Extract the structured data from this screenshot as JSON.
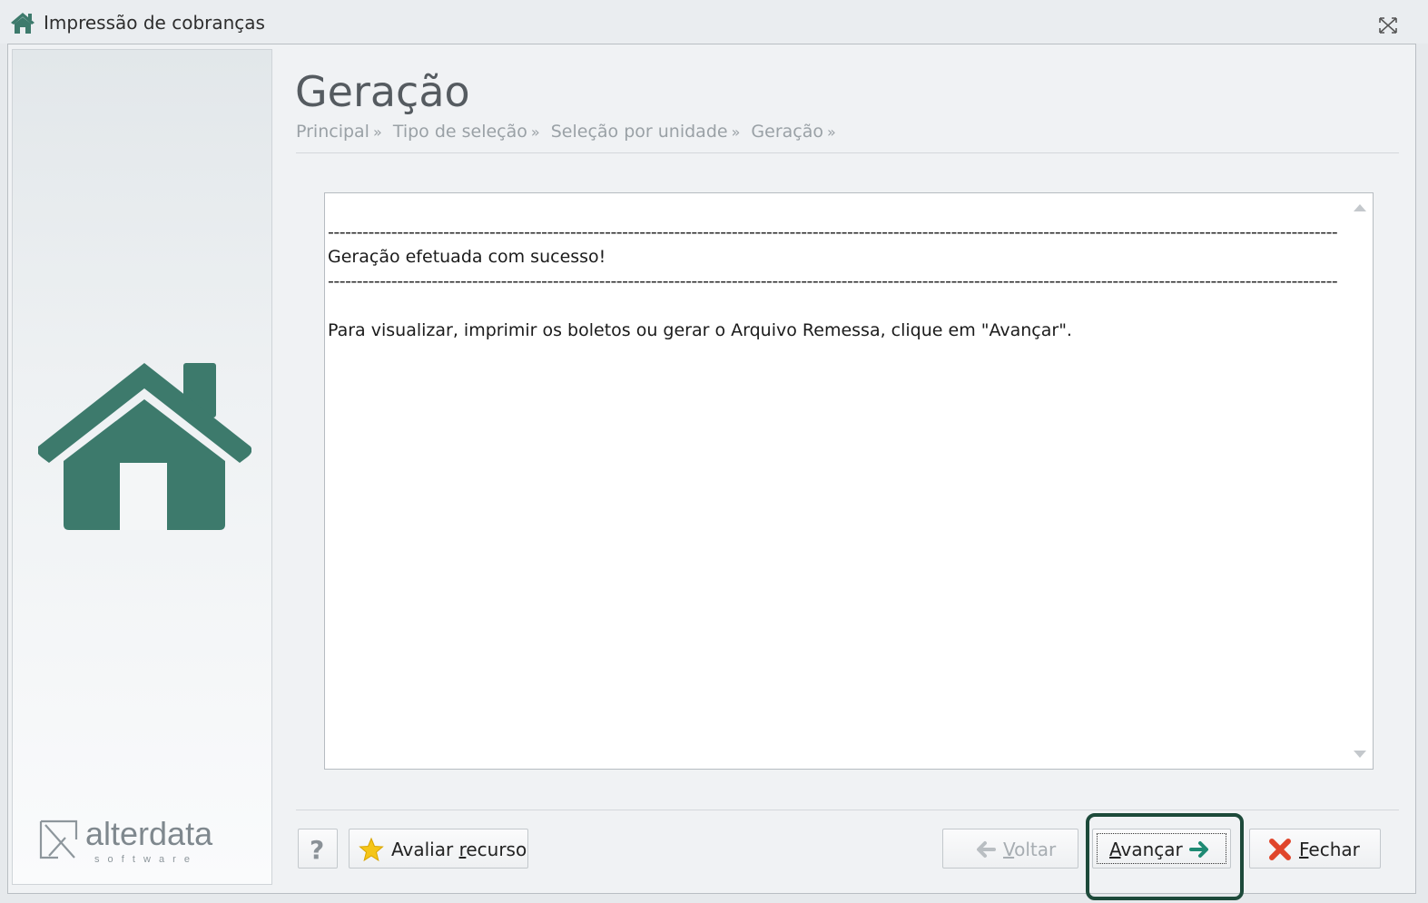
{
  "window": {
    "title": "Impressão de cobranças",
    "icon": "home-icon",
    "accent_color": "#3d7a6c"
  },
  "header": {
    "title": "Geração",
    "breadcrumb": {
      "items": [
        "Principal",
        "Tipo de seleção",
        "Seleção por unidade",
        "Geração"
      ],
      "separator": "»"
    }
  },
  "sidebar": {
    "illustration_icon": "home-icon",
    "brand": {
      "name": "alterdata",
      "tagline": "s o f t w a r e"
    }
  },
  "log": {
    "separator": "-------------------------------------------------------------------------------------------------------------------------------------------------------------------------------",
    "message": "Geração efetuada com sucesso!",
    "instruction": "Para visualizar, imprimir os boletos ou gerar o Arquivo Remessa, clique em \"Avançar\"."
  },
  "buttons": {
    "help": {
      "label": "?"
    },
    "rate": {
      "label_prefix": "Avaliar ",
      "label_mnemonic": "r",
      "label_rest": "ecurso",
      "icon": "star-icon"
    },
    "back": {
      "label_mnemonic": "V",
      "label_rest": "oltar",
      "icon": "arrow-left-icon",
      "enabled": false
    },
    "next": {
      "label_mnemonic": "A",
      "label_rest": "vançar",
      "icon": "arrow-right-icon",
      "focused": true
    },
    "close": {
      "label_mnemonic": "F",
      "label_rest": "echar",
      "icon": "close-x-icon"
    }
  },
  "highlight": {
    "target": "next",
    "color": "#1d4a3a"
  }
}
